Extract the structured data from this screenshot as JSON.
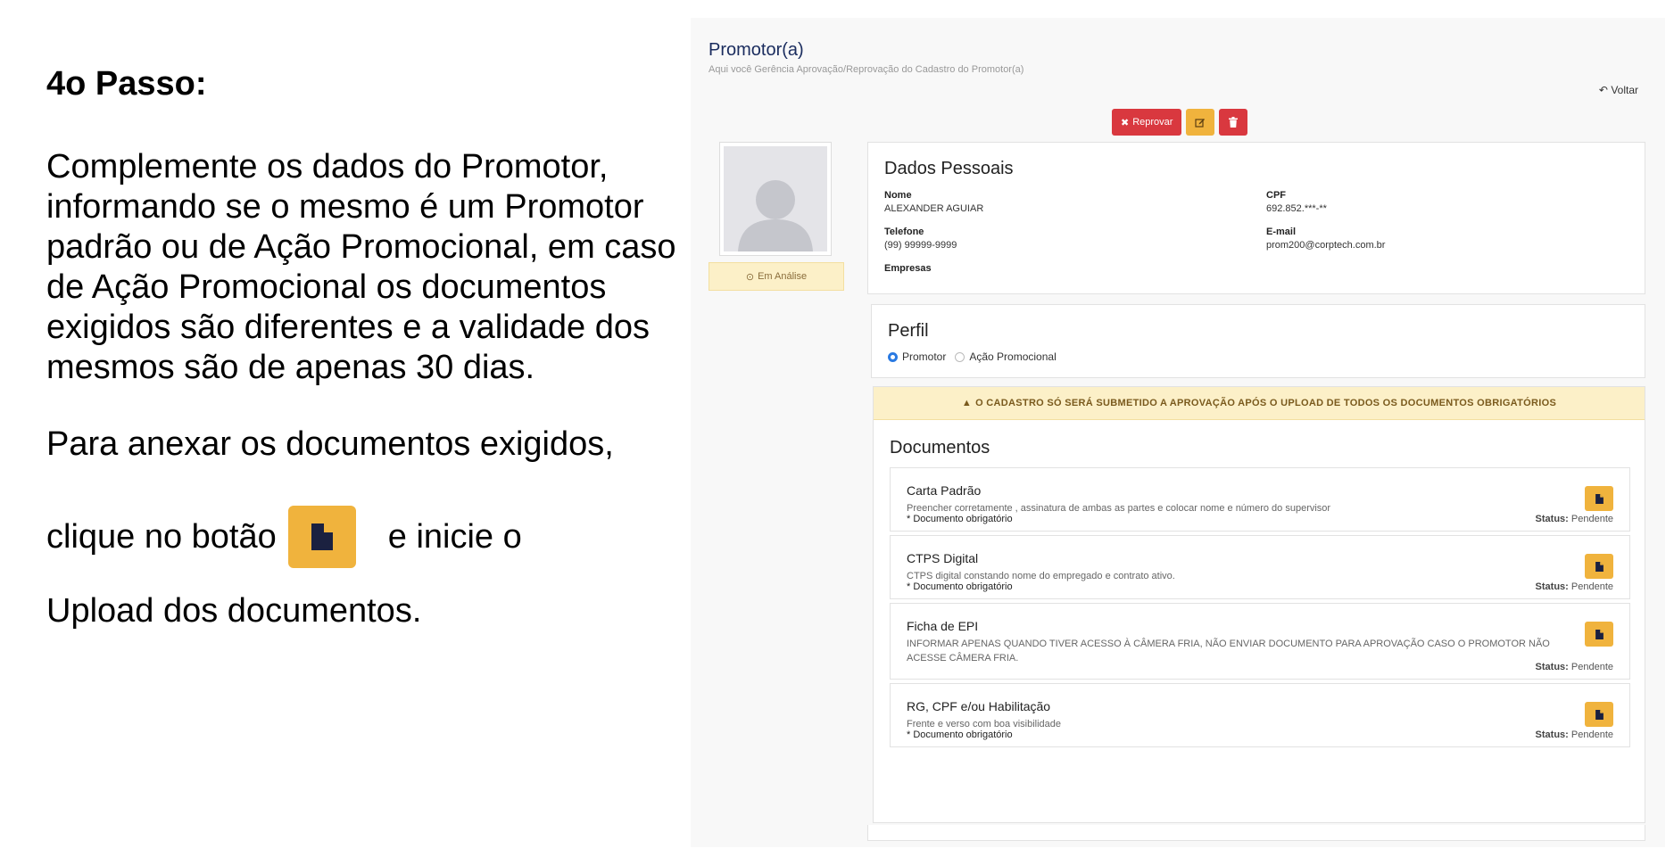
{
  "instructions": {
    "title": "4o Passo:",
    "paragraph1": "Complemente os dados do Promotor, informando se o mesmo é um Promotor padrão ou de Ação Promocional, em caso de Ação Promocional os documentos exigidos são diferentes e a validade dos mesmos são de apenas 30 dias.",
    "paragraph2": "Para anexar os documentos exigidos,",
    "line3_before": "clique no botão",
    "line3_after": "e inicie o",
    "line4": "Upload  dos documentos."
  },
  "page": {
    "title": "Promotor(a)",
    "subtitle": "Aqui você Gerência Aprovação/Reprovação do Cadastro do Promotor(a)",
    "back_label": "Voltar"
  },
  "actions": {
    "reject_label": "Reprovar"
  },
  "status_badge": "Em Análise",
  "personal": {
    "heading": "Dados Pessoais",
    "name_label": "Nome",
    "name_value": "ALEXANDER AGUIAR",
    "cpf_label": "CPF",
    "cpf_value": "692.852.***-**",
    "phone_label": "Telefone",
    "phone_value": "(99) 99999-9999",
    "email_label": "E-mail",
    "email_value": "prom200@corptech.com.br",
    "companies_label": "Empresas"
  },
  "profile": {
    "heading": "Perfil",
    "options": [
      {
        "label": "Promotor",
        "selected": true
      },
      {
        "label": "Ação Promocional",
        "selected": false
      }
    ]
  },
  "alert": "O CADASTRO SÓ SERÁ SUBMETIDO A APROVAÇÃO APÓS O UPLOAD DE TODOS OS DOCUMENTOS OBRIGATÓRIOS",
  "documents": {
    "heading": "Documentos",
    "status_label": "Status:",
    "items": [
      {
        "name": "Carta Padrão",
        "description": "Preencher corretamente , assinatura de ambas as partes e colocar nome e número do supervisor",
        "required": "* Documento obrigatório",
        "status": "Pendente"
      },
      {
        "name": "CTPS Digital",
        "description": "CTPS digital constando nome do empregado e contrato ativo.",
        "required": "* Documento obrigatório",
        "status": "Pendente"
      },
      {
        "name": "Ficha de EPI",
        "description": "INFORMAR APENAS QUANDO TIVER ACESSO À CÂMERA FRIA, NÃO ENVIAR DOCUMENTO PARA APROVAÇÃO CASO O PROMOTOR NÃO ACESSE CÂMERA FRIA.",
        "required": "",
        "status": "Pendente"
      },
      {
        "name": "RG, CPF e/ou Habilitação",
        "description": "Frente e verso com boa visibilidade",
        "required": "* Documento obrigatório",
        "status": "Pendente"
      }
    ]
  },
  "colors": {
    "accent_yellow": "#f0b33d",
    "danger_red": "#d9383f",
    "title_navy": "#1a2c5e",
    "alert_bg": "#fcf0c8"
  }
}
